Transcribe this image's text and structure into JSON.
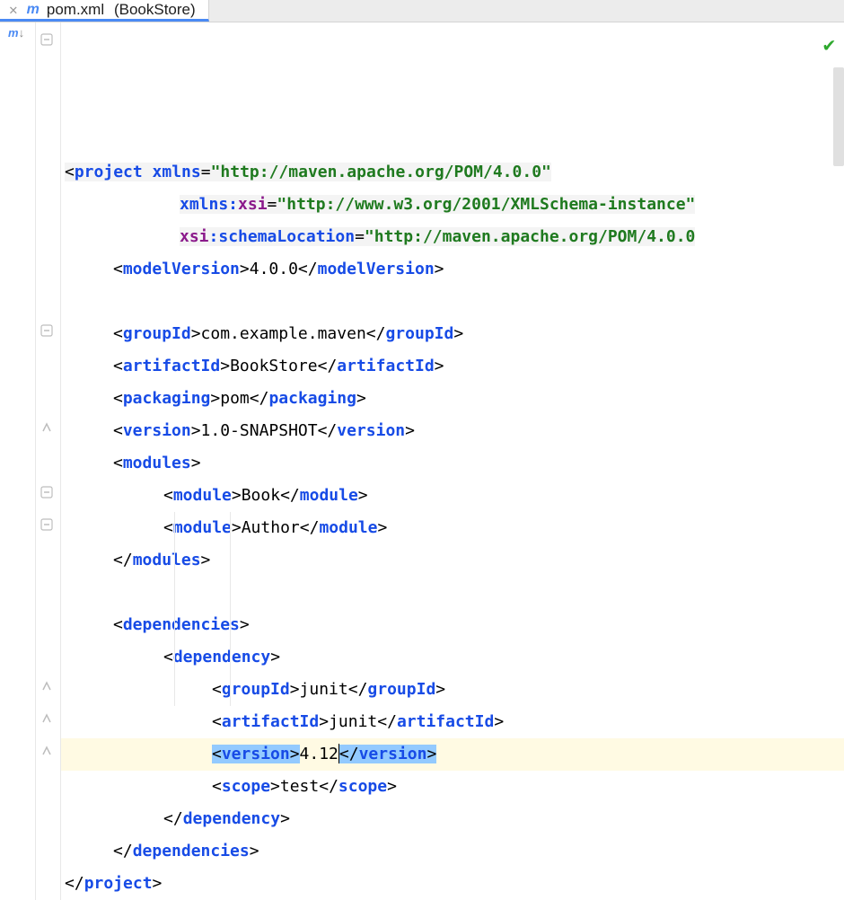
{
  "tab": {
    "filename": "pom.xml",
    "project": "(BookStore)"
  },
  "code": {
    "lines": [
      {
        "indent": "pad1",
        "segs": [
          {
            "t": "pun",
            "v": "<"
          },
          {
            "t": "tag",
            "v": "project"
          },
          {
            "t": "pun",
            "v": " "
          },
          {
            "t": "attr",
            "v": "xmlns"
          },
          {
            "t": "pun",
            "v": "="
          },
          {
            "t": "str",
            "v": "\"http://maven.apache.org/POM/4.0.0\""
          }
        ],
        "dim": true
      },
      {
        "indent": "pad2b",
        "segs": [
          {
            "t": "attr",
            "v": "xmlns:"
          },
          {
            "t": "ns",
            "v": "xsi"
          },
          {
            "t": "pun",
            "v": "="
          },
          {
            "t": "str",
            "v": "\"http://www.w3.org/2001/XMLSchema-instance\""
          }
        ],
        "dim": true
      },
      {
        "indent": "pad2b",
        "segs": [
          {
            "t": "ns",
            "v": "xsi"
          },
          {
            "t": "attr",
            "v": ":schemaLocation"
          },
          {
            "t": "pun",
            "v": "="
          },
          {
            "t": "str",
            "v": "\"http://maven.apache.org/POM/4.0.0"
          }
        ],
        "dim": true
      },
      {
        "indent": "pad2",
        "segs": [
          {
            "t": "pun",
            "v": "<"
          },
          {
            "t": "tag",
            "v": "modelVersion"
          },
          {
            "t": "pun",
            "v": ">"
          },
          {
            "t": "txt",
            "v": "4.0.0"
          },
          {
            "t": "pun",
            "v": "</"
          },
          {
            "t": "tag",
            "v": "modelVersion"
          },
          {
            "t": "pun",
            "v": ">"
          }
        ]
      },
      {
        "indent": "pad1",
        "segs": []
      },
      {
        "indent": "pad2",
        "segs": [
          {
            "t": "pun",
            "v": "<"
          },
          {
            "t": "tag",
            "v": "groupId"
          },
          {
            "t": "pun",
            "v": ">"
          },
          {
            "t": "txt",
            "v": "com.example.maven"
          },
          {
            "t": "pun",
            "v": "</"
          },
          {
            "t": "tag",
            "v": "groupId"
          },
          {
            "t": "pun",
            "v": ">"
          }
        ]
      },
      {
        "indent": "pad2",
        "segs": [
          {
            "t": "pun",
            "v": "<"
          },
          {
            "t": "tag",
            "v": "artifactId"
          },
          {
            "t": "pun",
            "v": ">"
          },
          {
            "t": "txt",
            "v": "BookStore"
          },
          {
            "t": "pun",
            "v": "</"
          },
          {
            "t": "tag",
            "v": "artifactId"
          },
          {
            "t": "pun",
            "v": ">"
          }
        ]
      },
      {
        "indent": "pad2",
        "segs": [
          {
            "t": "pun",
            "v": "<"
          },
          {
            "t": "tag",
            "v": "packaging"
          },
          {
            "t": "pun",
            "v": ">"
          },
          {
            "t": "txt",
            "v": "pom"
          },
          {
            "t": "pun",
            "v": "</"
          },
          {
            "t": "tag",
            "v": "packaging"
          },
          {
            "t": "pun",
            "v": ">"
          }
        ]
      },
      {
        "indent": "pad2",
        "segs": [
          {
            "t": "pun",
            "v": "<"
          },
          {
            "t": "tag",
            "v": "version"
          },
          {
            "t": "pun",
            "v": ">"
          },
          {
            "t": "txt",
            "v": "1.0-SNAPSHOT"
          },
          {
            "t": "pun",
            "v": "</"
          },
          {
            "t": "tag",
            "v": "version"
          },
          {
            "t": "pun",
            "v": ">"
          }
        ]
      },
      {
        "indent": "pad2",
        "segs": [
          {
            "t": "pun",
            "v": "<"
          },
          {
            "t": "tag",
            "v": "modules"
          },
          {
            "t": "pun",
            "v": ">"
          }
        ]
      },
      {
        "indent": "pad3",
        "segs": [
          {
            "t": "pun",
            "v": "<"
          },
          {
            "t": "tag",
            "v": "module"
          },
          {
            "t": "pun",
            "v": ">"
          },
          {
            "t": "txt",
            "v": "Book"
          },
          {
            "t": "pun",
            "v": "</"
          },
          {
            "t": "tag",
            "v": "module"
          },
          {
            "t": "pun",
            "v": ">"
          }
        ]
      },
      {
        "indent": "pad3",
        "segs": [
          {
            "t": "pun",
            "v": "<"
          },
          {
            "t": "tag",
            "v": "module"
          },
          {
            "t": "pun",
            "v": ">"
          },
          {
            "t": "txt",
            "v": "Author"
          },
          {
            "t": "pun",
            "v": "</"
          },
          {
            "t": "tag",
            "v": "module"
          },
          {
            "t": "pun",
            "v": ">"
          }
        ]
      },
      {
        "indent": "pad2",
        "segs": [
          {
            "t": "pun",
            "v": "</"
          },
          {
            "t": "tag",
            "v": "modules"
          },
          {
            "t": "pun",
            "v": ">"
          }
        ]
      },
      {
        "indent": "pad1",
        "segs": []
      },
      {
        "indent": "pad2",
        "segs": [
          {
            "t": "pun",
            "v": "<"
          },
          {
            "t": "tag",
            "v": "dependencies"
          },
          {
            "t": "pun",
            "v": ">"
          }
        ]
      },
      {
        "indent": "pad3",
        "segs": [
          {
            "t": "pun",
            "v": "<"
          },
          {
            "t": "tag",
            "v": "dependency"
          },
          {
            "t": "pun",
            "v": ">"
          }
        ]
      },
      {
        "indent": "pad4",
        "segs": [
          {
            "t": "pun",
            "v": "<"
          },
          {
            "t": "tag",
            "v": "groupId"
          },
          {
            "t": "pun",
            "v": ">"
          },
          {
            "t": "txt",
            "v": "junit"
          },
          {
            "t": "pun",
            "v": "</"
          },
          {
            "t": "tag",
            "v": "groupId"
          },
          {
            "t": "pun",
            "v": ">"
          }
        ]
      },
      {
        "indent": "pad4",
        "segs": [
          {
            "t": "pun",
            "v": "<"
          },
          {
            "t": "tag",
            "v": "artifactId"
          },
          {
            "t": "pun",
            "v": ">"
          },
          {
            "t": "txt",
            "v": "junit"
          },
          {
            "t": "pun",
            "v": "</"
          },
          {
            "t": "tag",
            "v": "artifactId"
          },
          {
            "t": "pun",
            "v": ">"
          }
        ]
      },
      {
        "indent": "pad4",
        "hl": true,
        "sel": true,
        "segs": [
          {
            "t": "pun",
            "v": "<",
            "sel": true
          },
          {
            "t": "tag",
            "v": "version",
            "sel": true
          },
          {
            "t": "pun",
            "v": ">",
            "sel": true
          },
          {
            "t": "txt",
            "v": "4.12"
          },
          {
            "t": "caret",
            "v": ""
          },
          {
            "t": "pun",
            "v": "</",
            "sel": true
          },
          {
            "t": "tag",
            "v": "version",
            "sel": true
          },
          {
            "t": "pun",
            "v": ">",
            "sel": true
          }
        ]
      },
      {
        "indent": "pad4",
        "segs": [
          {
            "t": "pun",
            "v": "<"
          },
          {
            "t": "tag",
            "v": "scope"
          },
          {
            "t": "pun",
            "v": ">"
          },
          {
            "t": "txt",
            "v": "test"
          },
          {
            "t": "pun",
            "v": "</"
          },
          {
            "t": "tag",
            "v": "scope"
          },
          {
            "t": "pun",
            "v": ">"
          }
        ]
      },
      {
        "indent": "pad3",
        "segs": [
          {
            "t": "pun",
            "v": "</"
          },
          {
            "t": "tag",
            "v": "dependency"
          },
          {
            "t": "pun",
            "v": ">"
          }
        ]
      },
      {
        "indent": "pad2",
        "segs": [
          {
            "t": "pun",
            "v": "</"
          },
          {
            "t": "tag",
            "v": "dependencies"
          },
          {
            "t": "pun",
            "v": ">"
          }
        ]
      },
      {
        "indent": "pad1",
        "segs": [
          {
            "t": "pun",
            "v": "</"
          },
          {
            "t": "tag",
            "v": "project"
          },
          {
            "t": "pun",
            "v": ">"
          }
        ]
      }
    ]
  },
  "folds": [
    {
      "line": 0,
      "kind": "open-down"
    },
    {
      "line": 9,
      "kind": "open-down"
    },
    {
      "line": 12,
      "kind": "close-up"
    },
    {
      "line": 14,
      "kind": "open-down"
    },
    {
      "line": 15,
      "kind": "open-down"
    },
    {
      "line": 20,
      "kind": "close-up"
    },
    {
      "line": 21,
      "kind": "close-up"
    },
    {
      "line": 22,
      "kind": "close-up"
    }
  ]
}
